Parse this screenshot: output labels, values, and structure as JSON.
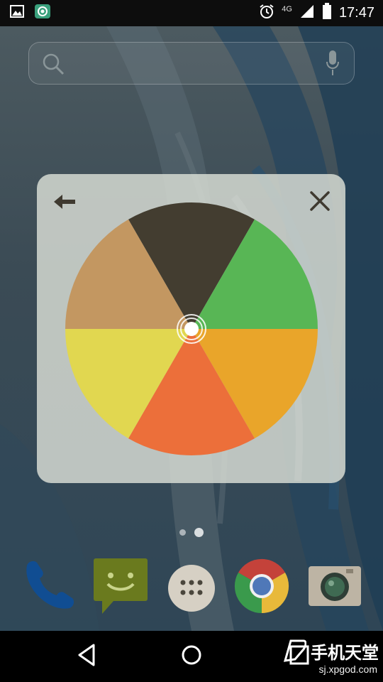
{
  "status_bar": {
    "time": "17:47",
    "network_label": "4G",
    "icons": [
      "gallery-icon",
      "screenshot-app-icon",
      "alarm-icon",
      "signal-icon",
      "battery-icon"
    ]
  },
  "search": {
    "icons": [
      "search-icon",
      "mic-icon"
    ]
  },
  "widget": {
    "icons": [
      "back-arrow-icon",
      "close-icon"
    ],
    "wheel_segments": [
      {
        "color": "#433d30"
      },
      {
        "color": "#58b655"
      },
      {
        "color": "#e9a52a"
      },
      {
        "color": "#ec6f3a"
      },
      {
        "color": "#e1d750"
      },
      {
        "color": "#c39761"
      }
    ]
  },
  "page_indicator": {
    "pages": 2,
    "active": 2
  },
  "dock": {
    "apps": [
      "phone-icon",
      "messaging-icon",
      "app-drawer-icon",
      "chrome-icon",
      "camera-icon"
    ]
  },
  "nav_bar": {
    "buttons": [
      "back-nav-icon",
      "home-nav-icon",
      "recents-nav-icon"
    ],
    "watermark": "手机天堂",
    "watermark_url": "sj.xpgod.com"
  }
}
